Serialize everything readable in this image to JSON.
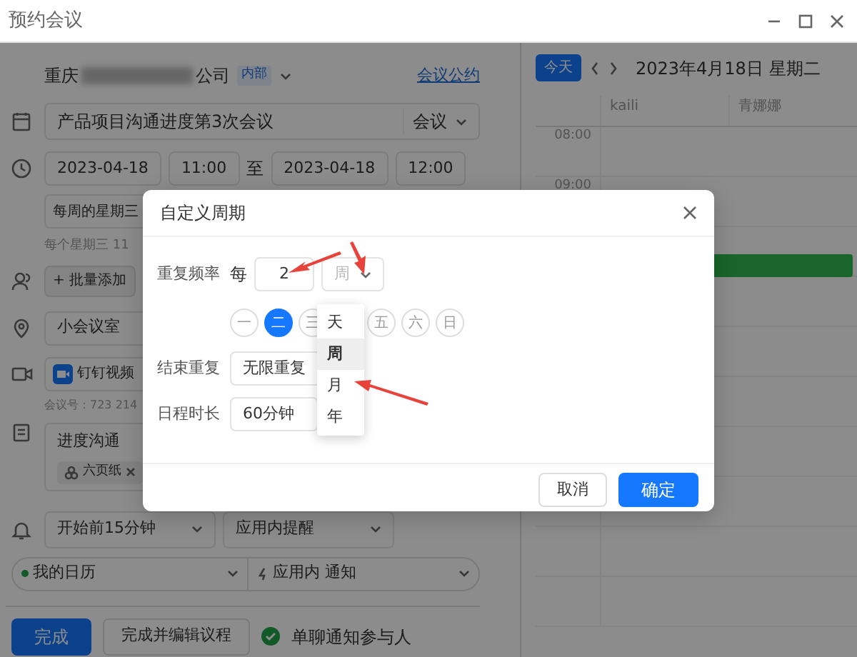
{
  "window": {
    "title": "预约会议"
  },
  "organizer": {
    "name_start": "重庆",
    "name_end": "公司",
    "tag": "内部",
    "link": "会议公约"
  },
  "title_field": {
    "value": "产品项目沟通进度第3次会议",
    "type": "会议"
  },
  "time": {
    "start_date": "2023-04-18",
    "start_time": "11:00",
    "separator": "至",
    "end_date": "2023-04-18",
    "end_time": "12:00"
  },
  "repeat": {
    "value": "每周的星期三",
    "hint": "每个星期三 11"
  },
  "attendees": {
    "add_button": "+ 批量添加"
  },
  "location": {
    "value": "小会议室"
  },
  "video": {
    "value": "钉钉视频",
    "meeting_id": "会议号：723 214"
  },
  "notes": {
    "value": "进度沟通",
    "attachment": "六页纸"
  },
  "reminder": {
    "time": "开始前15分钟",
    "method": "应用内提醒"
  },
  "calendar_select": {
    "calendar": "我的日历",
    "notify": "应用内 通知"
  },
  "actions": {
    "primary": "完成",
    "secondary": "完成并编辑议程",
    "notify_label": "单聊通知参与人",
    "notify_checked": true
  },
  "calendar": {
    "today_button": "今天",
    "date": "2023年4月18日 星期二",
    "columns": [
      "kaili",
      "青娜娜"
    ],
    "times": [
      "08:00",
      "09:00"
    ]
  },
  "dialog": {
    "title": "自定义周期",
    "frequency_label": "重复频率",
    "every": "每",
    "interval": "2",
    "unit": "周",
    "weekdays": [
      {
        "label": "一",
        "selected": false
      },
      {
        "label": "二",
        "selected": true
      },
      {
        "label": "三",
        "selected": false
      },
      {
        "label": "五",
        "selected": false
      },
      {
        "label": "六",
        "selected": false
      },
      {
        "label": "日",
        "selected": false
      }
    ],
    "end_label": "结束重复",
    "end_value": "无限重复",
    "duration_label": "日程时长",
    "duration_value": "60分钟",
    "unit_options": [
      {
        "label": "天",
        "selected": false
      },
      {
        "label": "周",
        "selected": true
      },
      {
        "label": "月",
        "selected": false
      },
      {
        "label": "年",
        "selected": false
      }
    ],
    "cancel": "取消",
    "ok": "确定"
  }
}
